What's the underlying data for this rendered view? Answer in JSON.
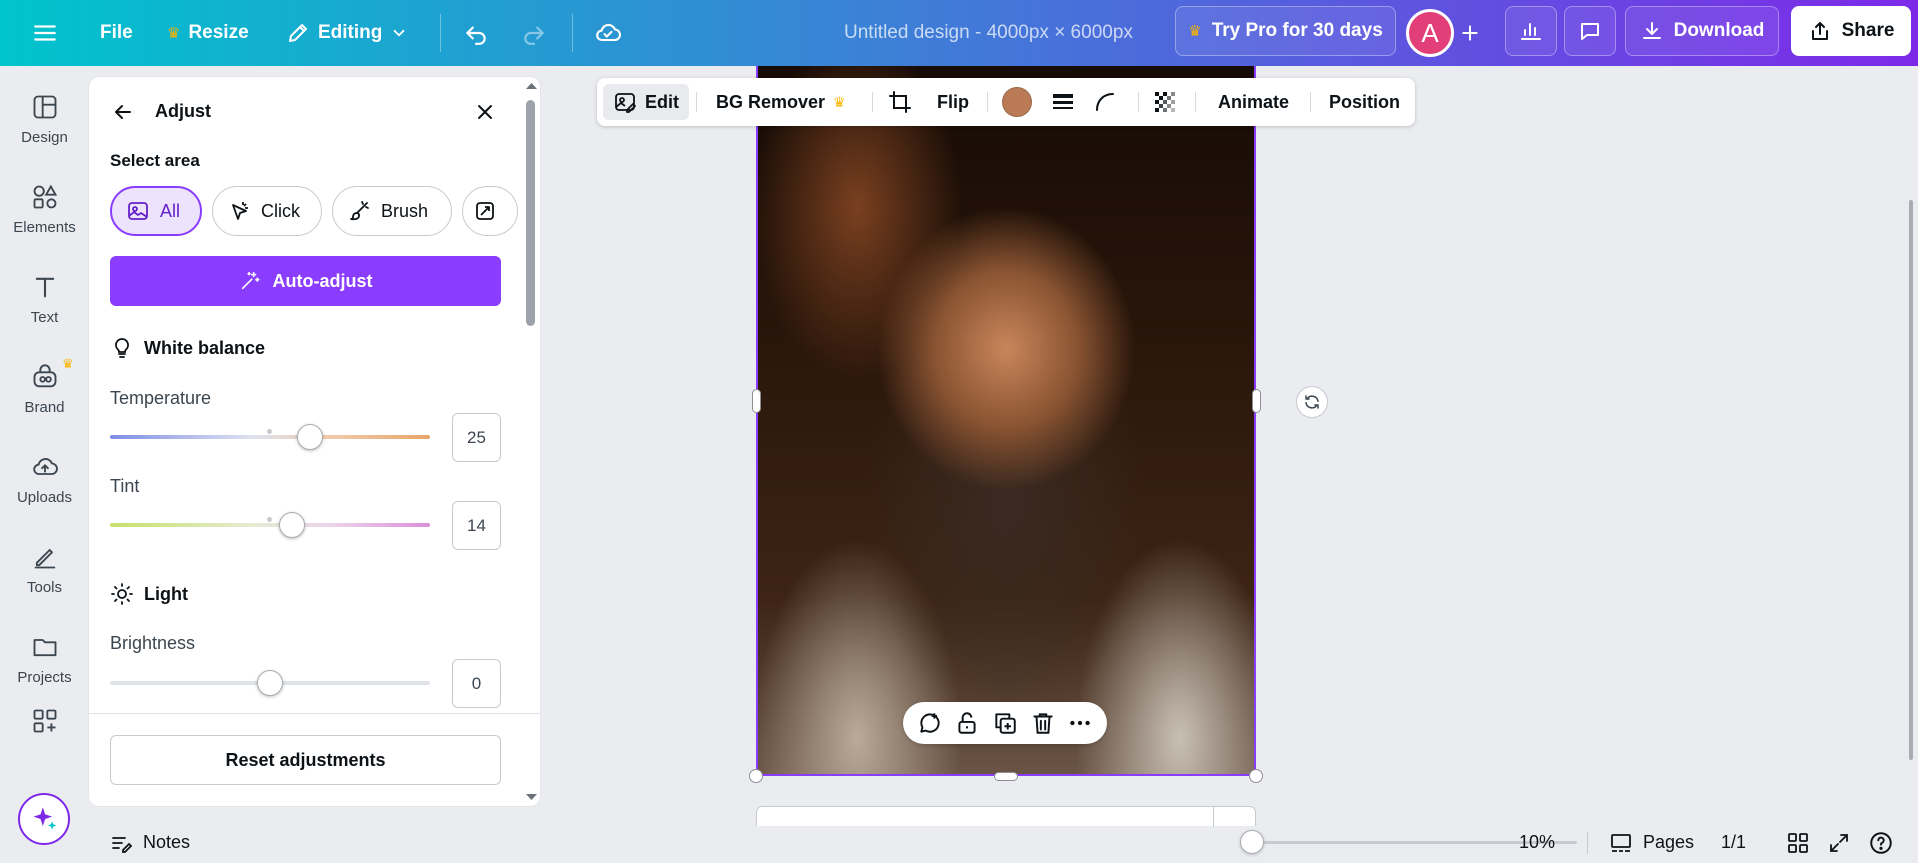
{
  "topbar": {
    "file_label": "File",
    "resize_label": "Resize",
    "editing_label": "Editing",
    "title": "Untitled design - 4000px × 6000px",
    "try_pro_label": "Try Pro for 30 days",
    "avatar_initial": "A",
    "download_label": "Download",
    "share_label": "Share"
  },
  "rail": {
    "items": [
      {
        "label": "Design",
        "icon": "design-icon"
      },
      {
        "label": "Elements",
        "icon": "elements-icon"
      },
      {
        "label": "Text",
        "icon": "text-icon"
      },
      {
        "label": "Brand",
        "icon": "brand-icon"
      },
      {
        "label": "Uploads",
        "icon": "uploads-icon"
      },
      {
        "label": "Tools",
        "icon": "tools-icon"
      },
      {
        "label": "Projects",
        "icon": "projects-icon"
      }
    ]
  },
  "panel": {
    "title": "Adjust",
    "select_area_label": "Select area",
    "chips": [
      "All",
      "Click",
      "Brush"
    ],
    "auto_adjust_label": "Auto-adjust",
    "white_balance_label": "White balance",
    "temperature": {
      "label": "Temperature",
      "value": "25",
      "level": 0.625
    },
    "tint": {
      "label": "Tint",
      "value": "14",
      "level": 0.57
    },
    "light_label": "Light",
    "brightness": {
      "label": "Brightness",
      "value": "0",
      "level": 0.5
    },
    "reset_label": "Reset adjustments"
  },
  "context_toolbar": {
    "edit_label": "Edit",
    "bg_remover_label": "BG Remover",
    "flip_label": "Flip",
    "animate_label": "Animate",
    "position_label": "Position",
    "color_swatch": "#b97a55"
  },
  "bottombar": {
    "notes_label": "Notes",
    "zoom_label": "10%",
    "pages_label": "Pages",
    "page_count": "1/1"
  },
  "colors": {
    "accent": "#8b3dff",
    "avatar": "#e23e77",
    "crown": "#f8b400"
  }
}
